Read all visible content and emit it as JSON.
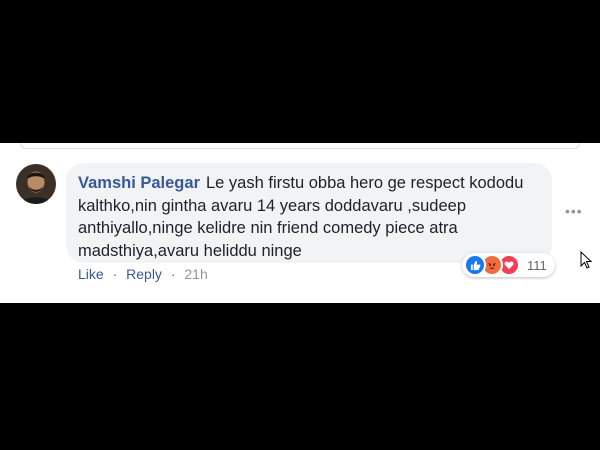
{
  "comment": {
    "author": "Vamshi Palegar",
    "text": "Le yash firstu obba hero ge respect kododu kalthko,nin gintha avaru 14 years doddavaru ,sudeep anthiyallo,ninge kelidre nin friend comedy piece atra madsthiya,avaru heliddu ninge",
    "more_label": "•••"
  },
  "actions": {
    "like_label": "Like",
    "separator": "·",
    "reply_label": "Reply",
    "time": "21h"
  },
  "reactions": {
    "icons": [
      "like-icon",
      "angry-icon",
      "love-icon"
    ],
    "count": "111",
    "colors": {
      "like": "#1877f2",
      "angry": "#f26c3d",
      "love": "#f33e58"
    }
  },
  "colors": {
    "author": "#385898",
    "bubble_bg": "#f2f3f5",
    "text": "#1d2129",
    "meta": "#606770"
  }
}
